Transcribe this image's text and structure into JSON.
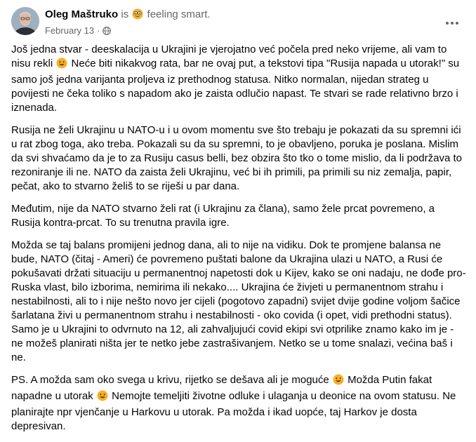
{
  "post": {
    "author": "Oleg Maštruko",
    "feeling_prefix": "is",
    "feeling_icon": "nerd-face-emoji",
    "feeling_text": "feeling smart.",
    "date": "February 13",
    "separator": "·",
    "privacy_icon": "globe-icon",
    "more_icon": "three-dots-icon",
    "paragraphs": [
      {
        "segments": [
          "Još jedna stvar - deeskalacija u Ukrajini je vjerojatno već počela pred neko vrijeme, ali vam to nisu rekli ",
          " Neće biti nikakvog rata, bar ne ovaj put, a tekstovi tipa \"Rusija napada u utorak!\" su samo još jedna varijanta proljeva iz prethodnog statusa. Nitko normalan, nijedan strateg u povijesti ne čeka toliko s napadom ako je zaista odlučio napast. Te stvari se rade relativno brzo i iznenada."
        ]
      },
      {
        "segments": [
          "Rusija ne želi Ukrajinu u NATO-u i u ovom momentu sve što trebaju je pokazati da su spremni ići u rat zbog toga, ako treba. Pokazali su da su spremni, to je obavljeno, poruka je poslana. Mislim da svi shvaćamo da je to za Rusiju casus belli, bez obzira što tko o tome mislio, da li podržava to rezoniranje ili ne. NATO da zaista želi Ukrajinu, već bi ih primili, pa primili su niz zemalja, papir, pečat, ako to stvarno želiš to se riješi u par dana."
        ]
      },
      {
        "segments": [
          "Međutim, nije da NATO stvarno želi rat (i Ukrajinu za člana), samo žele prcat povremeno, a Rusija kontra-prcat. To su trenutna pravila igre."
        ]
      },
      {
        "segments": [
          "Možda se taj balans promijeni jednog dana, ali to nije na vidiku. Dok te promjene balansa ne bude, NATO (čitaj - Ameri) će povremeno puštati balone da Ukrajina ulazi u NATO, a Rusi će pokušavati držati situaciju u permanentnoj napetosti dok u Kijev, kako se oni nadaju, ne dođe pro-Ruska vlast, bilo izborima, nemirima ili nekako.... Ukrajina će živjeti u permanentnom strahu i nestabilnosti, ali to i nije nešto novo jer cijeli (pogotovo zapadni) svijet dvije godine voljom šačice šarlatana živi u permanentnom strahu i nestabilnosti - oko covida (i opet, vidi prethodni status). Samo je u Ukrajini to odvrnuto na 12, ali zahvaljujući covid ekipi svi otprilike znamo kako im je - ne možeš planirati ništa jer te netko jebe zastrašivanjem. Netko se u tome snalazi, većina baš i ne."
        ]
      },
      {
        "segments": [
          "PS. A možda sam oko svega u krivu, rijetko se dešava ali je moguće ",
          " Možda Putin fakat napadne u utorak ",
          " Nemojte temeljiti životne odluke i ulaganja u deonice na ovom statusu. Ne planirajte npr vjenčanje u Harkovu u utorak. Pa možda i ikad uopće, taj Harkov je dosta depresivan."
        ]
      }
    ],
    "inline_emoji": "smiling-face-emoji",
    "colors": {
      "text": "#050505",
      "secondary": "#65676b",
      "emoji": "#f7b125"
    }
  }
}
